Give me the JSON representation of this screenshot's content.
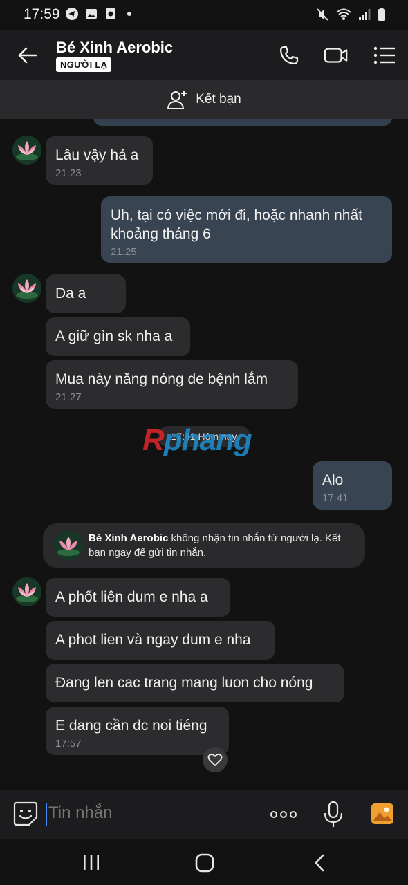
{
  "status_bar": {
    "time": "17:59"
  },
  "header": {
    "contact_name": "Bé Xinh Aerobic",
    "badge": "NGƯỜI LẠ"
  },
  "friend_bar": {
    "label": "Kết bạn"
  },
  "messages": [
    {
      "side": "in",
      "text": "Lâu vậy hả a",
      "time": "21:23"
    },
    {
      "side": "out",
      "text": "Uh, tại có việc mới đi, hoặc nhanh nhất khoảng tháng 6",
      "time": "21:25"
    },
    {
      "side": "in",
      "text": "Da a",
      "time": ""
    },
    {
      "side": "in",
      "text": "A giữ gìn sk nha a",
      "time": ""
    },
    {
      "side": "in",
      "text": "Mua này năng nóng de bệnh lắm",
      "time": "21:27"
    },
    {
      "side": "out",
      "text": "Alo",
      "time": "17:41"
    },
    {
      "side": "in",
      "text": "A phốt liên dum e nha a",
      "time": ""
    },
    {
      "side": "in",
      "text": "A phot lien và ngay dum e nha",
      "time": ""
    },
    {
      "side": "in",
      "text": "Đang len cac trang mang luon cho nóng",
      "time": ""
    },
    {
      "side": "in",
      "text": "E dang cần dc noi tiéng",
      "time": "17:57"
    }
  ],
  "date_separator": "17:41 Hôm nay",
  "watermark": {
    "part1": "R",
    "part2": "phang"
  },
  "notice": {
    "name": "Bé Xinh Aerobic",
    "text": " không nhận tin nhắn từ người lạ. Kết bạn ngay để gửi tin nhắn."
  },
  "composer": {
    "placeholder": "Tin nhắn"
  },
  "colors": {
    "incoming_bubble": "#2c2c2e",
    "outgoing_bubble": "#394453",
    "accent_caret": "#3d8bfd",
    "gallery_icon": "#f0a030"
  }
}
